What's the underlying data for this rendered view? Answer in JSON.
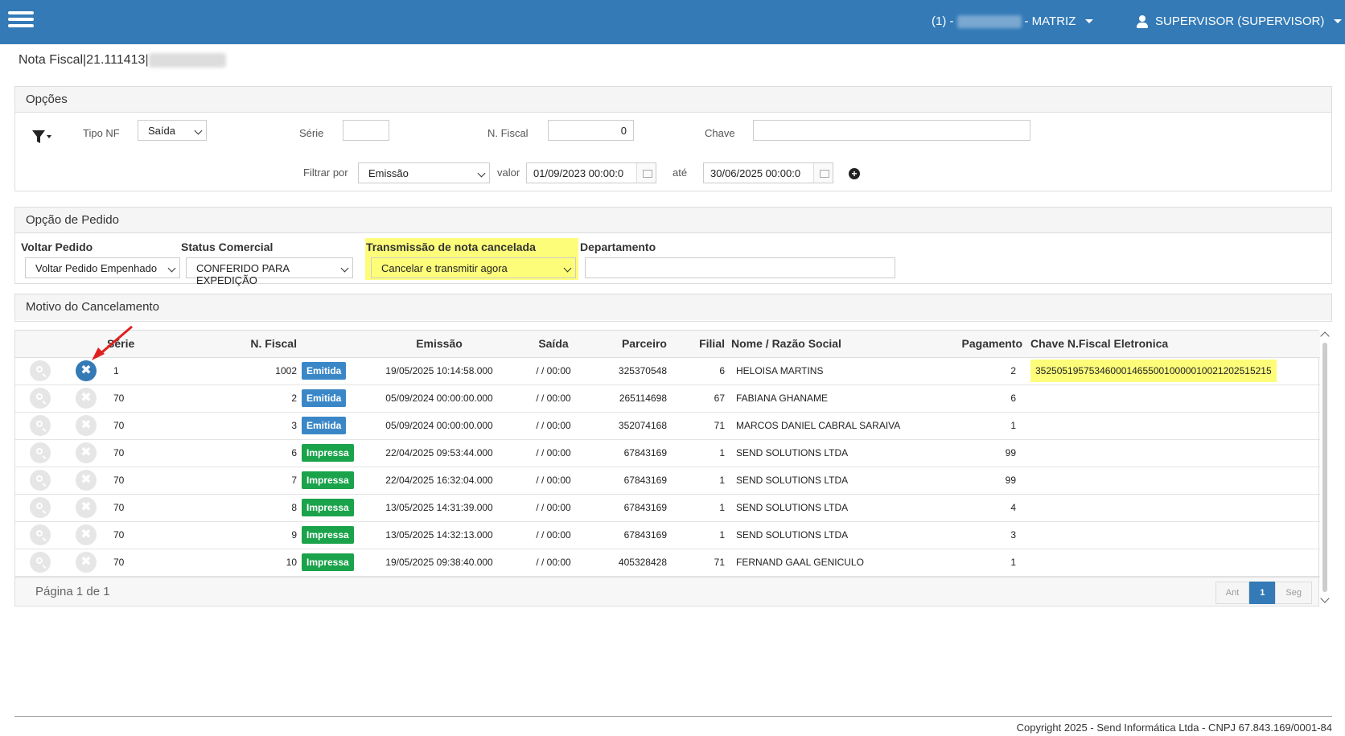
{
  "topbar": {
    "company_prefix": "(1) -",
    "company_suffix": "- MATRIZ",
    "user_label": "SUPERVISOR (SUPERVISOR)"
  },
  "page_title": "Nota Fiscal|21.111413|",
  "opcoes": {
    "title": "Opções",
    "tipo_nf_label": "Tipo NF",
    "tipo_nf_value": "Saída",
    "serie_label": "Série",
    "serie_value": "",
    "nfiscal_label": "N. Fiscal",
    "nfiscal_value": "0",
    "chave_label": "Chave",
    "chave_value": "",
    "filtrar_label": "Filtrar por",
    "filtrar_value": "Emissão",
    "valor_label": "valor",
    "valor_value": "01/09/2023 00:00:0",
    "ate_label": "até",
    "ate_value": "30/06/2025 00:00:0"
  },
  "pedido": {
    "title": "Opção de Pedido",
    "voltar_label": "Voltar Pedido",
    "voltar_value": "Voltar Pedido Empenhado",
    "status_label": "Status Comercial",
    "status_value": "CONFERIDO PARA EXPEDIÇÃO",
    "transmissao_label": "Transmissão de nota cancelada",
    "transmissao_value": "Cancelar e transmitir agora",
    "departamento_label": "Departamento",
    "departamento_value": ""
  },
  "motivo": {
    "title": "Motivo do Cancelamento"
  },
  "table": {
    "headers": [
      "",
      "",
      "Série",
      "N. Fiscal",
      "",
      "Emissão",
      "Saída",
      "Parceiro",
      "Filial",
      "Nome / Razão Social",
      "Pagamento",
      "Chave N.Fiscal Eletronica"
    ],
    "rows": [
      {
        "serie": "1",
        "nf": "1002",
        "status": "Emitida",
        "emissao": "19/05/2025 10:14:58.000",
        "saida": "/ / 00:00",
        "parceiro": "325370548",
        "filial": "6",
        "nome": "HELOISA MARTINS",
        "pagamento": "2",
        "chave": "35250519575346000146550010000010021202515215"
      },
      {
        "serie": "70",
        "nf": "2",
        "status": "Emitida",
        "emissao": "05/09/2024 00:00:00.000",
        "saida": "/ / 00:00",
        "parceiro": "265114698",
        "filial": "67",
        "nome": "FABIANA GHANAME",
        "pagamento": "6",
        "chave": ""
      },
      {
        "serie": "70",
        "nf": "3",
        "status": "Emitida",
        "emissao": "05/09/2024 00:00:00.000",
        "saida": "/ / 00:00",
        "parceiro": "352074168",
        "filial": "71",
        "nome": "MARCOS DANIEL CABRAL SARAIVA",
        "pagamento": "1",
        "chave": ""
      },
      {
        "serie": "70",
        "nf": "6",
        "status": "Impressa",
        "emissao": "22/04/2025 09:53:44.000",
        "saida": "/ / 00:00",
        "parceiro": "67843169",
        "filial": "1",
        "nome": "SEND SOLUTIONS LTDA",
        "pagamento": "99",
        "chave": ""
      },
      {
        "serie": "70",
        "nf": "7",
        "status": "Impressa",
        "emissao": "22/04/2025 16:32:04.000",
        "saida": "/ / 00:00",
        "parceiro": "67843169",
        "filial": "1",
        "nome": "SEND SOLUTIONS LTDA",
        "pagamento": "99",
        "chave": ""
      },
      {
        "serie": "70",
        "nf": "8",
        "status": "Impressa",
        "emissao": "13/05/2025 14:31:39.000",
        "saida": "/ / 00:00",
        "parceiro": "67843169",
        "filial": "1",
        "nome": "SEND SOLUTIONS LTDA",
        "pagamento": "4",
        "chave": ""
      },
      {
        "serie": "70",
        "nf": "9",
        "status": "Impressa",
        "emissao": "13/05/2025 14:32:13.000",
        "saida": "/ / 00:00",
        "parceiro": "67843169",
        "filial": "1",
        "nome": "SEND SOLUTIONS LTDA",
        "pagamento": "3",
        "chave": ""
      },
      {
        "serie": "70",
        "nf": "10",
        "status": "Impressa",
        "emissao": "19/05/2025 09:38:40.000",
        "saida": "/ / 00:00",
        "parceiro": "405328428",
        "filial": "71",
        "nome": "FERNAND GAAL GENICULO",
        "pagamento": "1",
        "chave": ""
      }
    ],
    "page_info": "Página 1 de 1",
    "pager": {
      "prev": "Ant",
      "current": "1",
      "next": "Seg"
    }
  },
  "footer": {
    "copyright": "Copyright 2025 - Send Informática Ltda - CNPJ 67.843.169/0001-84"
  },
  "colors": {
    "primary": "#337ab7",
    "highlight": "#fdfd7a",
    "emitida": "#3a87c8",
    "impressa": "#1aa34a"
  }
}
